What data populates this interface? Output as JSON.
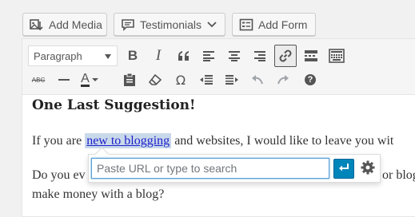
{
  "media_buttons": {
    "add_media": "Add Media",
    "testimonials": "Testimonials",
    "add_form": "Add Form"
  },
  "toolbar": {
    "format_select": "Paragraph",
    "row1_icons": [
      "bold-icon",
      "italic-icon",
      "blockquote-icon",
      "align-left-icon",
      "align-center-icon",
      "align-right-icon",
      "link-icon",
      "read-more-icon",
      "toolbar-toggle-icon"
    ],
    "row2_icons": [
      "strikethrough-icon",
      "horizontal-line-icon",
      "text-color-icon",
      "paste-text-icon",
      "clear-formatting-icon",
      "special-character-icon",
      "outdent-icon",
      "indent-icon",
      "undo-icon",
      "redo-icon",
      "help-icon"
    ],
    "bold_glyph": "B",
    "italic_glyph": "I",
    "text_color_glyph": "A",
    "omega_glyph": "Ω",
    "help_glyph": "?",
    "strike_glyph": "ABC"
  },
  "content": {
    "heading": "One Last Suggestion!",
    "para1_before": "If you are ",
    "para1_link": "new to blogging",
    "para1_after": " and websites, I would like to leave you wit",
    "para2_line1_start": "Do you ev",
    "para2_line1_end": "or blog",
    "para2_line2": "make money with a blog?"
  },
  "link_popup": {
    "placeholder": "Paste URL or type to search",
    "value": ""
  },
  "colors": {
    "accent": "#0085ba",
    "link": "#1e1ecb",
    "selection": "#c8d9ea"
  }
}
